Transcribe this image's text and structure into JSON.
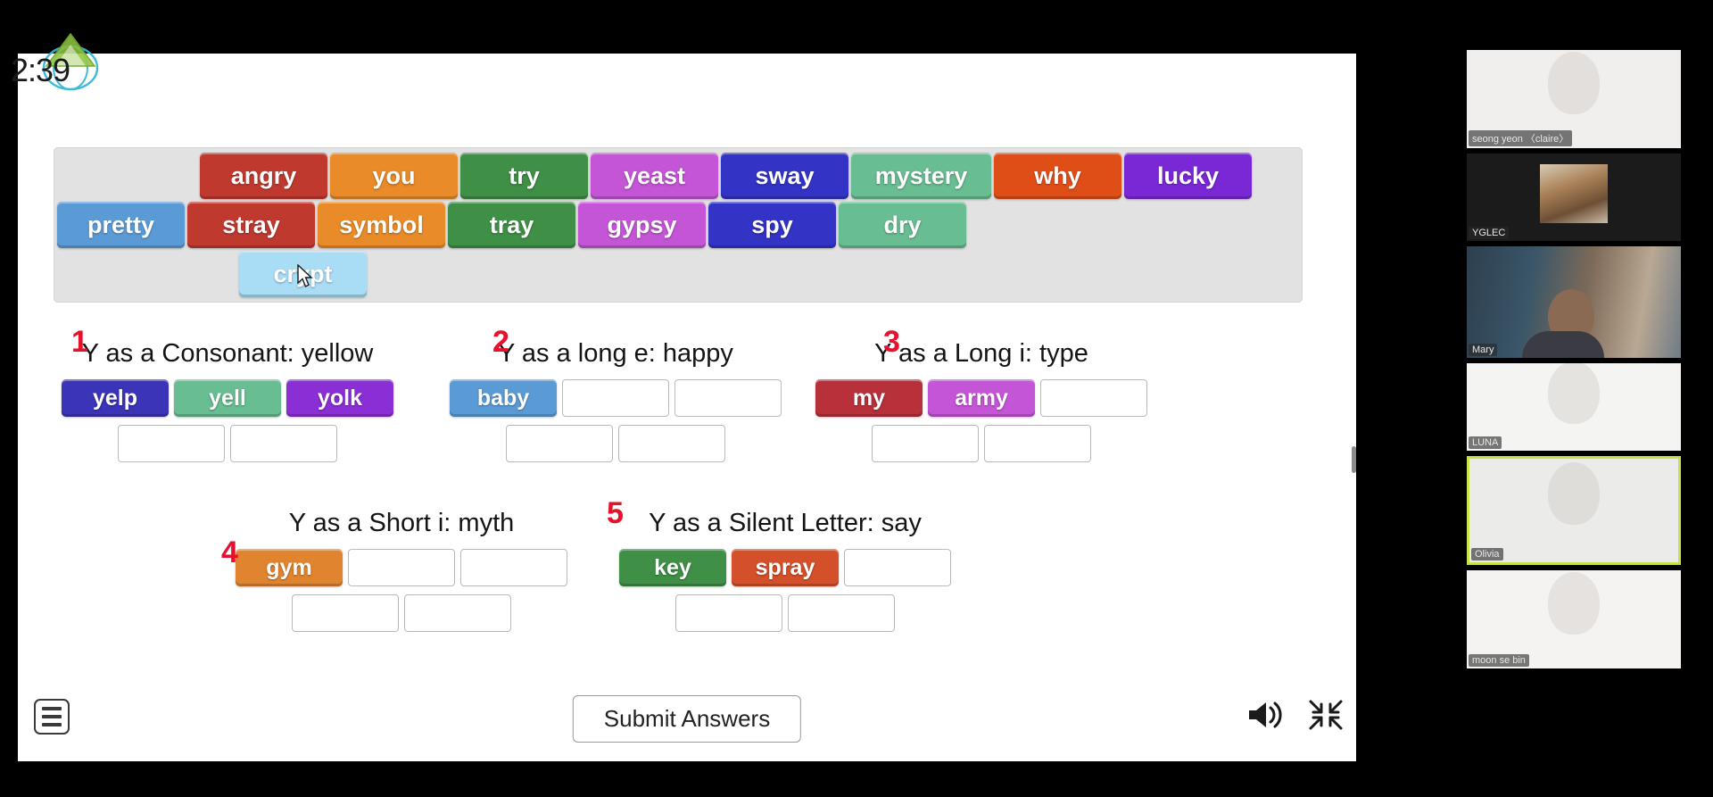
{
  "timer": "2:39",
  "wordbank": {
    "name": "word-bank",
    "rows": [
      [
        {
          "text": "angry",
          "color": "#c0392f",
          "w": "w-md"
        },
        {
          "text": "you",
          "color": "#e98b28",
          "w": "w-md"
        },
        {
          "text": "try",
          "color": "#3f8f46",
          "w": "w-md"
        },
        {
          "text": "yeast",
          "color": "#c455d6",
          "w": "w-md"
        },
        {
          "text": "sway",
          "color": "#3333c6",
          "w": "w-md"
        },
        {
          "text": "mystery",
          "color": "#68bd92",
          "w": "w-lg"
        },
        {
          "text": "why",
          "color": "#e04e18",
          "w": "w-md"
        },
        {
          "text": "lucky",
          "color": "#7a28d6",
          "w": "w-md"
        }
      ],
      [
        {
          "text": "pretty",
          "color": "#5b9bd5",
          "w": "w-md"
        },
        {
          "text": "stray",
          "color": "#c0392f",
          "w": "w-md"
        },
        {
          "text": "symbol",
          "color": "#e98b28",
          "w": "w-md"
        },
        {
          "text": "tray",
          "color": "#3f8f46",
          "w": "w-md"
        },
        {
          "text": "gypsy",
          "color": "#c455d6",
          "w": "w-md"
        },
        {
          "text": "spy",
          "color": "#3333c6",
          "w": "w-md"
        },
        {
          "text": "dry",
          "color": "#68bd92",
          "w": "w-md"
        }
      ],
      [
        {
          "text": "crypt",
          "color": "#a9dcf5",
          "w": "w-md"
        }
      ]
    ]
  },
  "categories": [
    {
      "number": "1",
      "title": "Y as a Consonant: yellow",
      "row1": [
        {
          "kind": "tile",
          "text": "yelp",
          "color": "#3b33b8"
        },
        {
          "kind": "tile",
          "text": "yell",
          "color": "#68bd92"
        },
        {
          "kind": "tile",
          "text": "yolk",
          "color": "#8a2ed6"
        }
      ],
      "row2": [
        {
          "kind": "slot"
        },
        {
          "kind": "slot"
        }
      ]
    },
    {
      "number": "2",
      "title": "Y as a long e: happy",
      "row1": [
        {
          "kind": "tile",
          "text": "baby",
          "color": "#5b9bd5"
        },
        {
          "kind": "slot"
        },
        {
          "kind": "slot"
        }
      ],
      "row2": [
        {
          "kind": "slot"
        },
        {
          "kind": "slot"
        }
      ]
    },
    {
      "number": "3",
      "title": "Y as a Long i: type",
      "row1": [
        {
          "kind": "tile",
          "text": "my",
          "color": "#b7303a"
        },
        {
          "kind": "tile",
          "text": "army",
          "color": "#c455d6"
        },
        {
          "kind": "slot"
        }
      ],
      "row2": [
        {
          "kind": "slot"
        },
        {
          "kind": "slot"
        }
      ]
    },
    {
      "number": "4",
      "title": "Y as a Short i: myth",
      "row1": [
        {
          "kind": "tile",
          "text": "gym",
          "color": "#e08430"
        },
        {
          "kind": "slot"
        },
        {
          "kind": "slot"
        }
      ],
      "row2": [
        {
          "kind": "slot"
        },
        {
          "kind": "slot"
        }
      ]
    },
    {
      "number": "5",
      "title": "Y as a Silent Letter: say",
      "row1": [
        {
          "kind": "tile",
          "text": "key",
          "color": "#3f8f46"
        },
        {
          "kind": "tile",
          "text": "spray",
          "color": "#d4502a"
        },
        {
          "kind": "slot"
        }
      ],
      "row2": [
        {
          "kind": "slot"
        },
        {
          "kind": "slot"
        }
      ]
    }
  ],
  "bottom": {
    "menu_icon": "hamburger-menu-icon",
    "submit_label": "Submit Answers",
    "sound_icon": "speaker-volume-icon",
    "fullscreen_icon": "exit-fullscreen-icon"
  },
  "video_rail": {
    "participants": [
      {
        "name": "seong yeon 〈claire〉"
      },
      {
        "name": "YGLEC"
      },
      {
        "name": "Mary"
      },
      {
        "name": "LUNA"
      },
      {
        "name": "Olivia"
      },
      {
        "name": "moon se bin"
      }
    ],
    "active_speaker": "Olivia",
    "active_border_color": "#c8e04a"
  },
  "colors": {
    "annotation_red": "#e8112d",
    "board_background": "#ffffff",
    "page_background": "#000000",
    "wordbank_background": "#e2e2e2"
  }
}
